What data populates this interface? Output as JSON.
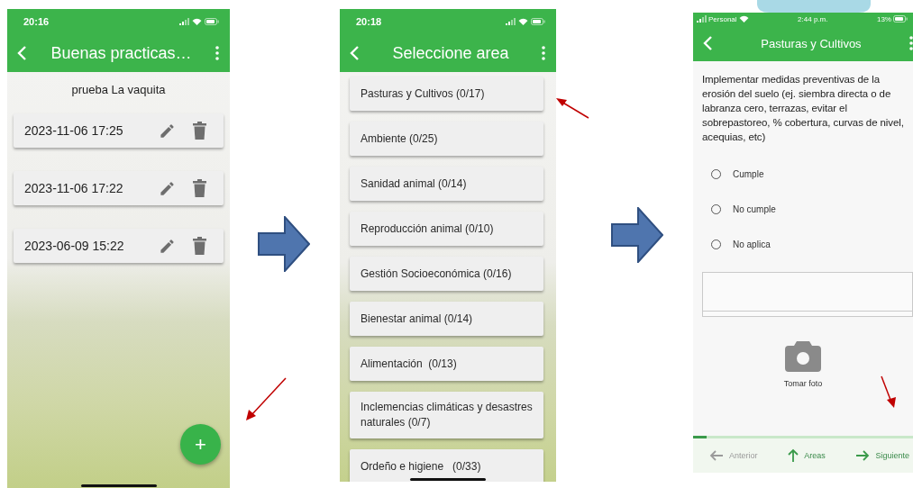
{
  "list_screen": {
    "status_bar": {
      "time": "20:16"
    },
    "app_bar": {
      "title": "Buenas practicas…"
    },
    "subtitle": "prueba La vaquita",
    "records": [
      {
        "date": "2023-11-06 17:25"
      },
      {
        "date": "2023-11-06 17:22"
      },
      {
        "date": "2023-06-09 15:22"
      }
    ],
    "fab": {
      "label": "+"
    }
  },
  "area_screen": {
    "status_bar": {
      "time": "20:18"
    },
    "app_bar": {
      "title": "Seleccione area"
    },
    "areas": [
      {
        "label": "Pasturas y Cultivos (0/17)"
      },
      {
        "label": "Ambiente (0/25)"
      },
      {
        "label": "Sanidad animal (0/14)"
      },
      {
        "label": "Reproducción animal (0/10)"
      },
      {
        "label": "Gestión Socioeconómica (0/16)"
      },
      {
        "label": "Bienestar animal (0/14)"
      },
      {
        "label": "Alimentación  (0/13)"
      },
      {
        "label": "Inclemencias climáticas y desastres naturales (0/7)"
      },
      {
        "label": "Ordeño e higiene   (0/33)"
      }
    ]
  },
  "question_screen": {
    "status_bar": {
      "carrier": "Personal",
      "time": "2:44 p.m.",
      "battery": "13%"
    },
    "app_bar": {
      "title": "Pasturas y Cultivos"
    },
    "question": "Implementar medidas preventivas de la erosión del suelo (ej. siembra directa o de labranza cero, terrazas, evitar el sobrepastoreo, % cobertura, curvas de nivel, acequias, etc)",
    "options": [
      {
        "label": "Cumple",
        "selected": false
      },
      {
        "label": "No cumple",
        "selected": false
      },
      {
        "label": "No aplica",
        "selected": false
      }
    ],
    "photo_button": {
      "label": "Tomar foto"
    },
    "progress": {
      "level": 0.06
    },
    "nav": [
      {
        "kind": "back",
        "label": "Anterior",
        "disabled": true
      },
      {
        "kind": "up",
        "label": "Areas",
        "disabled": false
      },
      {
        "kind": "next",
        "label": "Siguiente",
        "disabled": false
      }
    ]
  }
}
